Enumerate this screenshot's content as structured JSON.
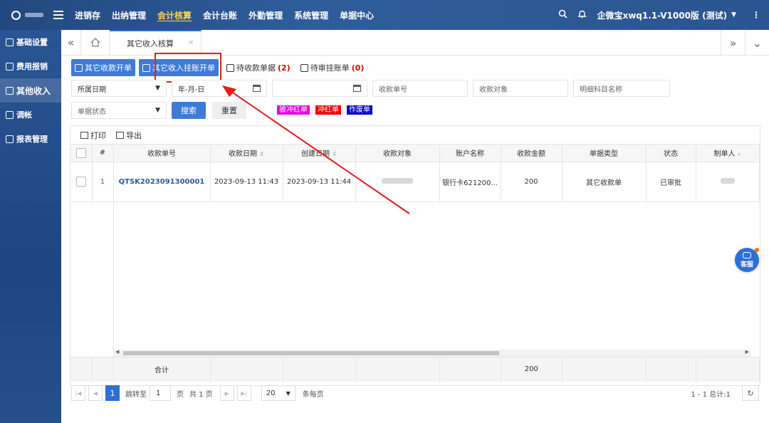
{
  "topbar": {
    "nav": [
      "进销存",
      "出纳管理",
      "会计核算",
      "会计台账",
      "外勤管理",
      "系统管理",
      "单据中心"
    ],
    "active_nav": "会计核算",
    "company": "企微宝xwq1.1-V1000版 (测试)",
    "search_icon": "search-icon",
    "bell_icon": "bell-icon",
    "more_icon": "more-vertical-icon"
  },
  "sidebar": {
    "items": [
      {
        "label": "基础设置",
        "icon": "layers-icon"
      },
      {
        "label": "费用报销",
        "icon": "receipt-icon"
      },
      {
        "label": "其他收入",
        "icon": "income-icon"
      },
      {
        "label": "调帐",
        "icon": "adjust-icon"
      },
      {
        "label": "报表管理",
        "icon": "report-icon"
      }
    ],
    "active": "其他收入"
  },
  "tabs": {
    "active_tab": "其它收入核算"
  },
  "toolbar": {
    "btn1": "其它收款开单",
    "btn2": "其它收入挂账开单",
    "btn3": "待收款单据",
    "btn3_count": "(2)",
    "btn4": "待审挂账单",
    "btn4_count": "(0)"
  },
  "filters": {
    "date_type": "所属日期",
    "date_start": "年-月-日",
    "date_end": "",
    "receipt_no_ph": "收款单号",
    "payee_ph": "收款对象",
    "subject_ph": "明细科目名称",
    "status_ph": "单据状态",
    "search_btn": "搜索",
    "reset_btn": "重置",
    "tags": [
      {
        "label": "被冲红单",
        "color": "#e600e6"
      },
      {
        "label": "冲红单",
        "color": "#ee0000"
      },
      {
        "label": "作废单",
        "color": "#0000cc"
      }
    ]
  },
  "grid": {
    "print": "打印",
    "export": "导出",
    "columns": [
      "#",
      "收款单号",
      "收款日期",
      "创建日期",
      "收款对象",
      "账户名称",
      "收款金额",
      "单据类型",
      "状态",
      "制单人"
    ],
    "rows": [
      {
        "idx": "1",
        "receipt_no": "QTSK2023091300001",
        "receipt_date": "2023-09-13 11:43",
        "created_date": "2023-09-13 11:44",
        "account": "银行卡621200...",
        "amount": "200",
        "doc_type": "其它收款单",
        "status": "已审批"
      }
    ],
    "footer_label": "合计",
    "footer_amount": "200"
  },
  "pager": {
    "current_page": "1",
    "jump_label": "跳转至",
    "jump_value": "1",
    "page_unit": "页",
    "total_pages": "共 1 页",
    "page_size": "20",
    "per_page": "条每页",
    "summary": "1 - 1 总计:1"
  },
  "service": {
    "label": "客服"
  },
  "colors": {
    "accent": "#3e7ad9",
    "highlight": "#e51c1c"
  }
}
